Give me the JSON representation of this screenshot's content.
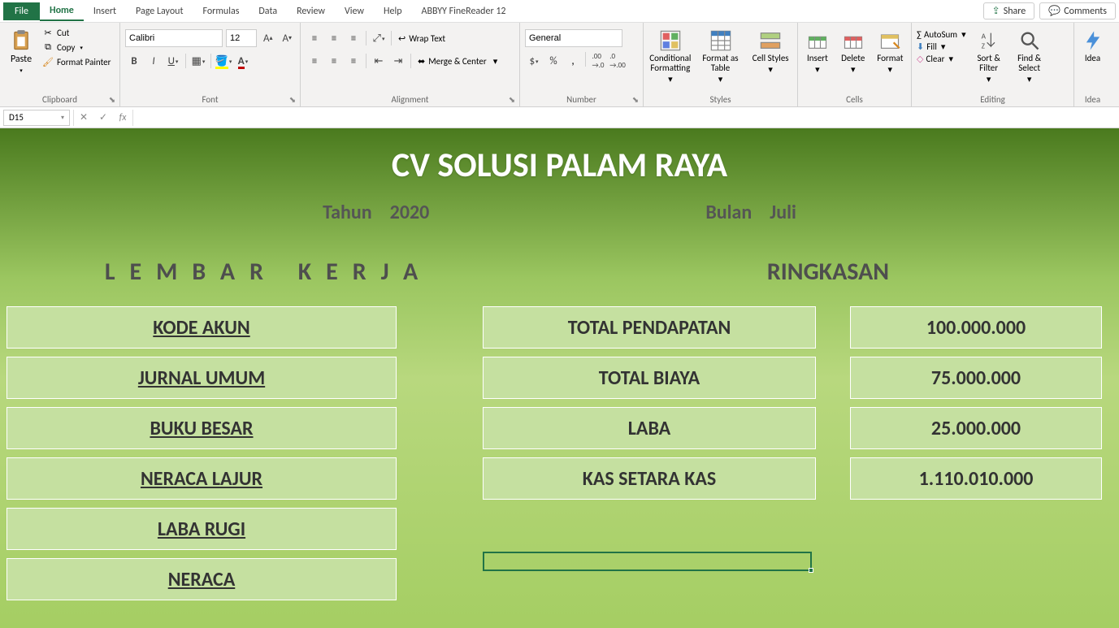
{
  "menu": {
    "file": "File",
    "home": "Home",
    "insert": "Insert",
    "pageLayout": "Page Layout",
    "formulas": "Formulas",
    "data": "Data",
    "review": "Review",
    "view": "View",
    "help": "Help",
    "abbyy": "ABBYY FineReader 12",
    "share": "Share",
    "comments": "Comments"
  },
  "ribbon": {
    "clipboard": {
      "label": "Clipboard",
      "paste": "Paste",
      "cut": "Cut",
      "copy": "Copy",
      "formatPainter": "Format Painter"
    },
    "font": {
      "label": "Font",
      "name": "Calibri",
      "size": "12"
    },
    "alignment": {
      "label": "Alignment",
      "wrap": "Wrap Text",
      "merge": "Merge & Center"
    },
    "number": {
      "label": "Number",
      "format": "General"
    },
    "styles": {
      "label": "Styles",
      "conditional": "Conditional Formatting",
      "formatAs": "Format as Table",
      "cell": "Cell Styles"
    },
    "cells": {
      "label": "Cells",
      "insert": "Insert",
      "delete": "Delete",
      "format": "Format"
    },
    "editing": {
      "label": "Editing",
      "autosum": "AutoSum",
      "fill": "Fill",
      "clear": "Clear",
      "sortFilter": "Sort & Filter",
      "findSelect": "Find & Select"
    },
    "ideas": {
      "label": "Idea",
      "btn": "Idea"
    }
  },
  "nameBox": "D15",
  "sheet": {
    "company": "CV SOLUSI PALAM RAYA",
    "tahunLabel": "Tahun",
    "tahunValue": "2020",
    "bulanLabel": "Bulan",
    "bulanValue": "Juli",
    "lembarKerja": "LEMBAR KERJA",
    "ringkasan": "RINGKASAN",
    "links": {
      "kodeAkun": "KODE AKUN",
      "jurnalUmum": "JURNAL UMUM",
      "bukuBesar": "BUKU BESAR",
      "neracaLajur": "NERACA LAJUR",
      "labaRugi": "LABA RUGI",
      "neraca": "NERACA"
    },
    "summaryLabels": {
      "totalPendapatan": "TOTAL PENDAPATAN",
      "totalBiaya": "TOTAL BIAYA",
      "laba": "LABA",
      "kas": "KAS SETARA KAS"
    },
    "summaryValues": {
      "totalPendapatan": "100.000.000",
      "totalBiaya": "75.000.000",
      "laba": "25.000.000",
      "kas": "1.110.010.000"
    }
  }
}
